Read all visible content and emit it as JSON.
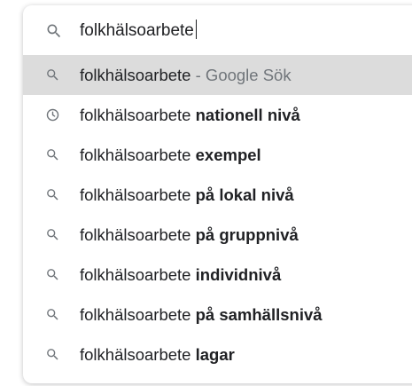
{
  "search": {
    "query": "folkhälsoarbete",
    "icon": "search-icon"
  },
  "suggestions": [
    {
      "icon": "search-icon",
      "prefix": "folkhälsoarbete",
      "bold": "",
      "suffix": " - Google Sök",
      "highlighted": true
    },
    {
      "icon": "history-icon",
      "prefix": "folkhälsoarbete ",
      "bold": "nationell nivå",
      "suffix": ""
    },
    {
      "icon": "search-icon",
      "prefix": "folkhälsoarbete ",
      "bold": "exempel",
      "suffix": ""
    },
    {
      "icon": "search-icon",
      "prefix": "folkhälsoarbete ",
      "bold": "på lokal nivå",
      "suffix": ""
    },
    {
      "icon": "search-icon",
      "prefix": "folkhälsoarbete ",
      "bold": "på gruppnivå",
      "suffix": ""
    },
    {
      "icon": "search-icon",
      "prefix": "folkhälsoarbete ",
      "bold": "individnivå",
      "suffix": ""
    },
    {
      "icon": "search-icon",
      "prefix": "folkhälsoarbete ",
      "bold": "på samhällsnivå",
      "suffix": ""
    },
    {
      "icon": "search-icon",
      "prefix": "folkhälsoarbete ",
      "bold": "lagar",
      "suffix": ""
    }
  ],
  "colors": {
    "highlight": "#dcdcdc",
    "text": "#202124",
    "muted": "#70757a",
    "icon": "#70757a"
  }
}
